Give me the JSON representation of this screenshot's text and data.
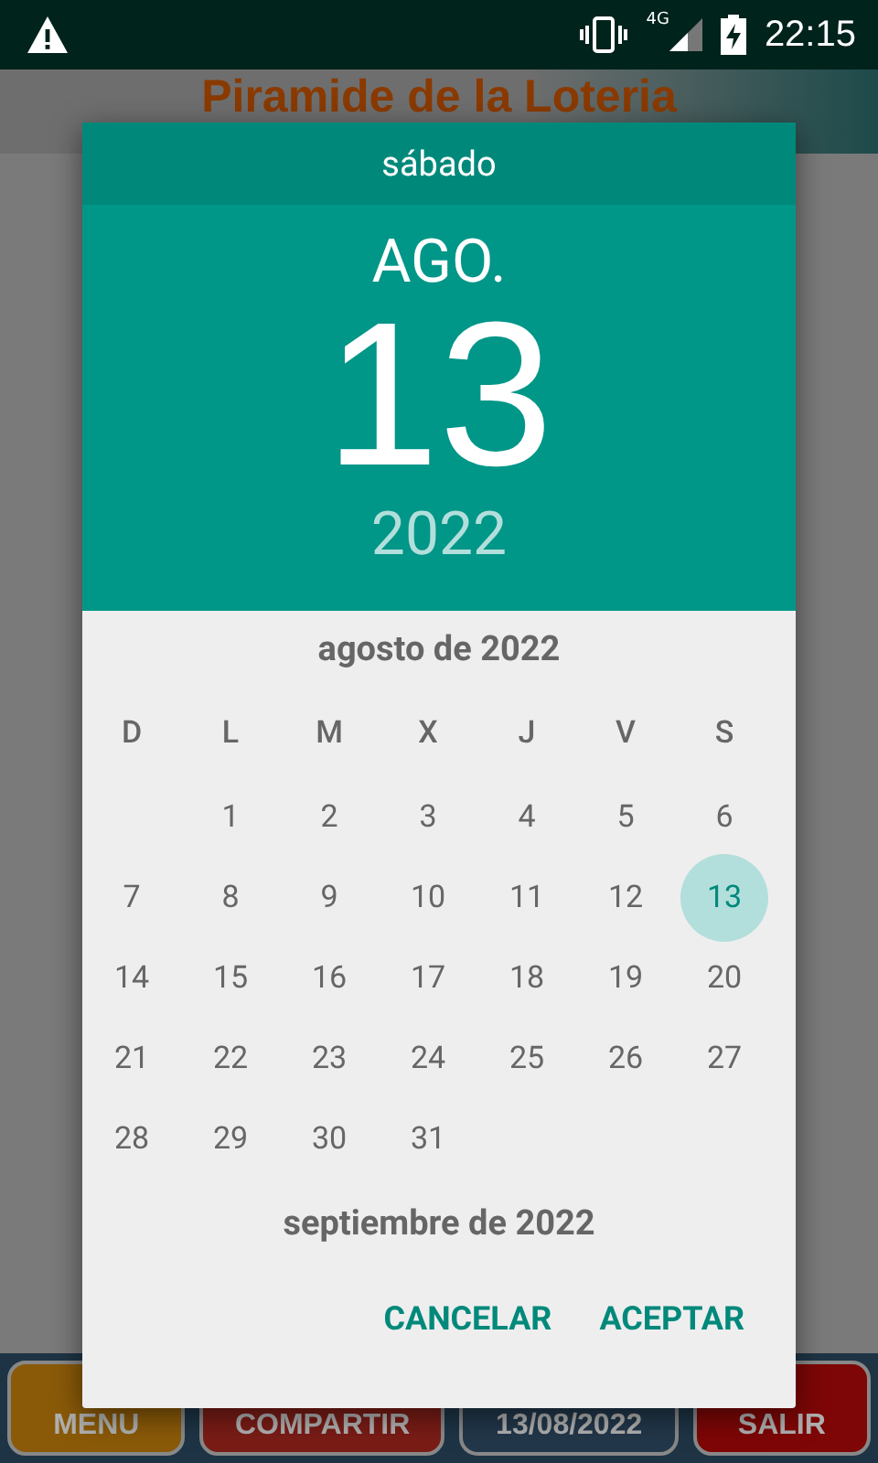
{
  "status_bar": {
    "network": "4G",
    "time": "22:15"
  },
  "app": {
    "title": "Piramide de la Loteria",
    "buttons": [
      {
        "label": "MENU",
        "color": "#8a5a08"
      },
      {
        "label": "COMPARTIR",
        "color": "#7a1c16"
      },
      {
        "label": "13/08/2022",
        "color": "#22374a"
      },
      {
        "label": "SALIR",
        "color": "#7e0606"
      }
    ]
  },
  "dialog": {
    "weekday": "sábado",
    "month": "AGO.",
    "day": "13",
    "year": "2022",
    "month_title": "agosto de 2022",
    "weekday_headers": [
      "D",
      "L",
      "M",
      "X",
      "J",
      "V",
      "S"
    ],
    "weeks": [
      [
        {
          "kind": "blank"
        },
        {
          "kind": "day",
          "label": "1",
          "selected": false
        },
        {
          "kind": "day",
          "label": "2",
          "selected": false
        },
        {
          "kind": "day",
          "label": "3",
          "selected": false
        },
        {
          "kind": "day",
          "label": "4",
          "selected": false
        },
        {
          "kind": "day",
          "label": "5",
          "selected": false
        },
        {
          "kind": "day",
          "label": "6",
          "selected": false
        }
      ],
      [
        {
          "kind": "day",
          "label": "7",
          "selected": false
        },
        {
          "kind": "day",
          "label": "8",
          "selected": false
        },
        {
          "kind": "day",
          "label": "9",
          "selected": false
        },
        {
          "kind": "day",
          "label": "10",
          "selected": false
        },
        {
          "kind": "day",
          "label": "11",
          "selected": false
        },
        {
          "kind": "day",
          "label": "12",
          "selected": false
        },
        {
          "kind": "day",
          "label": "13",
          "selected": true
        }
      ],
      [
        {
          "kind": "day",
          "label": "14",
          "selected": false
        },
        {
          "kind": "day",
          "label": "15",
          "selected": false
        },
        {
          "kind": "day",
          "label": "16",
          "selected": false
        },
        {
          "kind": "day",
          "label": "17",
          "selected": false
        },
        {
          "kind": "day",
          "label": "18",
          "selected": false
        },
        {
          "kind": "day",
          "label": "19",
          "selected": false
        },
        {
          "kind": "day",
          "label": "20",
          "selected": false
        }
      ],
      [
        {
          "kind": "day",
          "label": "21",
          "selected": false
        },
        {
          "kind": "day",
          "label": "22",
          "selected": false
        },
        {
          "kind": "day",
          "label": "23",
          "selected": false
        },
        {
          "kind": "day",
          "label": "24",
          "selected": false
        },
        {
          "kind": "day",
          "label": "25",
          "selected": false
        },
        {
          "kind": "day",
          "label": "26",
          "selected": false
        },
        {
          "kind": "day",
          "label": "27",
          "selected": false
        }
      ],
      [
        {
          "kind": "day",
          "label": "28",
          "selected": false
        },
        {
          "kind": "day",
          "label": "29",
          "selected": false
        },
        {
          "kind": "day",
          "label": "30",
          "selected": false
        },
        {
          "kind": "day",
          "label": "31",
          "selected": false
        }
      ]
    ],
    "next_month_title": "septiembre de 2022",
    "buttons": [
      "CANCELAR",
      "ACEPTAR"
    ]
  }
}
